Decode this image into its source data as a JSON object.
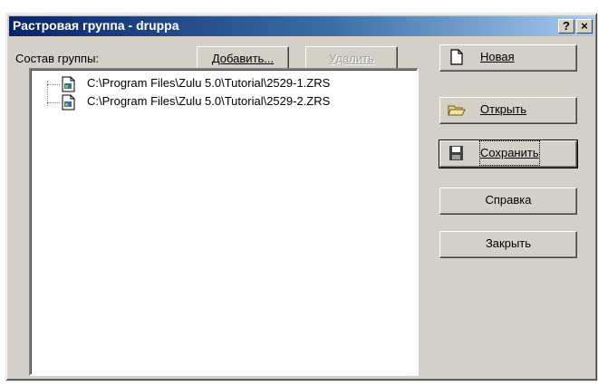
{
  "window": {
    "title": "Растровая группа - druppa",
    "help_label": "?",
    "close_label": "×"
  },
  "group": {
    "label": "Состав группы:",
    "add_label": "Добавить...",
    "remove_label": "Удалить",
    "files": [
      "C:\\Program Files\\Zulu 5.0\\Tutorial\\2529-1.ZRS",
      "C:\\Program Files\\Zulu 5.0\\Tutorial\\2529-2.ZRS"
    ]
  },
  "actions": {
    "new_label": "Новая",
    "open_label": "Открыть",
    "save_label": "Сохранить",
    "help_label": "Справка",
    "close_label": "Закрыть"
  },
  "icons": {
    "new": "new-document-icon",
    "open": "open-folder-icon",
    "save": "floppy-disk-icon",
    "file": "raster-file-icon"
  }
}
